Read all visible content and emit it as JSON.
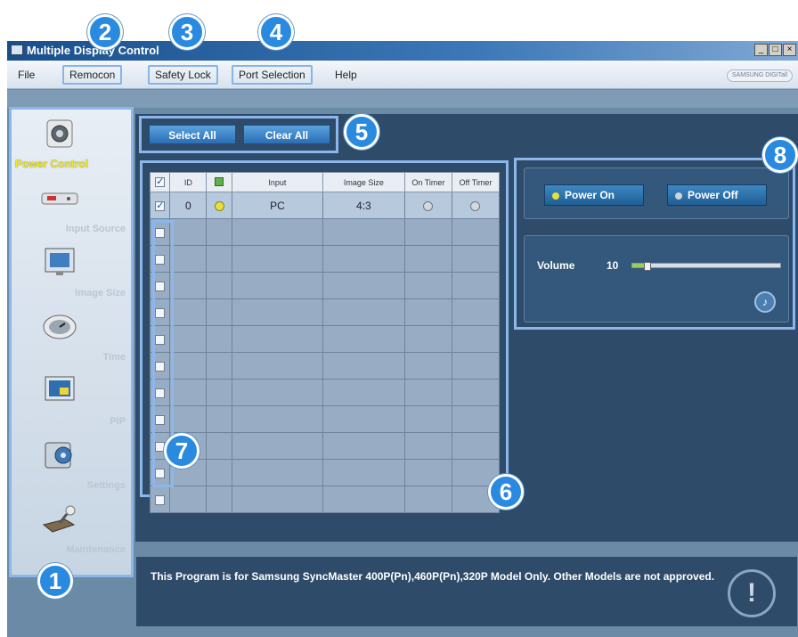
{
  "window": {
    "title": "Multiple Display Control",
    "controls": [
      "_",
      "□",
      "×"
    ]
  },
  "menu": {
    "items": [
      {
        "label": "File",
        "boxed": false
      },
      {
        "label": "Remocon",
        "boxed": true
      },
      {
        "label": "Safety Lock",
        "boxed": true
      },
      {
        "label": "Port Selection",
        "boxed": true
      },
      {
        "label": "Help",
        "boxed": false
      }
    ],
    "logo": "SAMSUNG DIGITall"
  },
  "sidebar": {
    "items": [
      {
        "label": "Power Control",
        "icon": "power-control-icon",
        "active": true
      },
      {
        "label": "Input Source",
        "icon": "input-source-icon",
        "active": false
      },
      {
        "label": "Image Size",
        "icon": "image-size-icon",
        "active": false
      },
      {
        "label": "Time",
        "icon": "time-icon",
        "active": false
      },
      {
        "label": "PIP",
        "icon": "pip-icon",
        "active": false
      },
      {
        "label": "Settings",
        "icon": "settings-icon",
        "active": false
      },
      {
        "label": "Maintenance",
        "icon": "maintenance-icon",
        "active": false
      }
    ]
  },
  "selection": {
    "select_all": "Select All",
    "clear_all": "Clear All"
  },
  "grid": {
    "headers": [
      "",
      "ID",
      "",
      "Input",
      "Image Size",
      "On Timer",
      "Off Timer"
    ],
    "rows": [
      {
        "checked": true,
        "id": "0",
        "status": "yellow",
        "input": "PC",
        "image_size": "4:3",
        "on_timer": "grey",
        "off_timer": "grey"
      }
    ],
    "empty_rows": 11
  },
  "power": {
    "power_on": "Power On",
    "power_off": "Power Off",
    "power_on_led": "#e8e03a",
    "power_off_led": "#d0d4d8"
  },
  "volume": {
    "label": "Volume",
    "value": "10",
    "level": 0.1
  },
  "footer": {
    "message": "This Program is for Samsung SyncMaster 400P(Pn),460P(Pn),320P  Model Only. Other Models are not approved.",
    "icon": "!"
  },
  "callouts": [
    "1",
    "2",
    "3",
    "4",
    "5",
    "6",
    "7",
    "8"
  ],
  "colors": {
    "highlight": "#8cb7ea",
    "active_label": "#f2e92b",
    "callout": "#2a8ae0"
  }
}
